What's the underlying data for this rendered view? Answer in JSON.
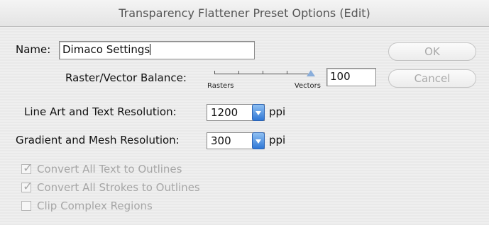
{
  "window": {
    "title": "Transparency Flattener Preset Options (Edit)"
  },
  "name_field": {
    "label": "Name:",
    "value": "Dimaco Settings"
  },
  "balance": {
    "label": "Raster/Vector Balance:",
    "left_label": "Rasters",
    "right_label": "Vectors",
    "value": "100",
    "level_percent": 100
  },
  "line_art": {
    "label": "Line Art and Text Resolution:",
    "value": "1200",
    "unit": "ppi"
  },
  "gradient": {
    "label": "Gradient and Mesh Resolution:",
    "value": "300",
    "unit": "ppi"
  },
  "options": [
    {
      "label": "Convert All Text to Outlines",
      "checked": true
    },
    {
      "label": "Convert All Strokes to Outlines",
      "checked": true
    },
    {
      "label": "Clip Complex Regions",
      "checked": false
    }
  ],
  "buttons": {
    "ok": "OK",
    "cancel": "Cancel"
  },
  "colors": {
    "accent": "#2f77d6",
    "disabled_text": "#a6a6a6"
  }
}
